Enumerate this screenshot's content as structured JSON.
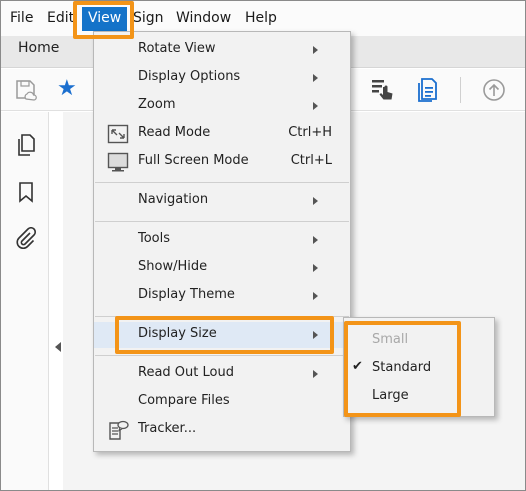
{
  "menubar": {
    "items": [
      "File",
      "Edit",
      "View",
      "Sign",
      "Window",
      "Help"
    ]
  },
  "tabs": {
    "home": "Home"
  },
  "view_menu": {
    "items": [
      {
        "label": "Rotate View",
        "submenu": true
      },
      {
        "label": "Display Options",
        "submenu": true
      },
      {
        "label": "Zoom",
        "submenu": true
      },
      {
        "label": "Read Mode",
        "shortcut": "Ctrl+H",
        "icon": "read-mode-icon"
      },
      {
        "label": "Full Screen Mode",
        "shortcut": "Ctrl+L",
        "icon": "full-screen-icon"
      },
      {
        "label": "Navigation",
        "submenu": true
      },
      {
        "label": "Tools",
        "submenu": true
      },
      {
        "label": "Show/Hide",
        "submenu": true
      },
      {
        "label": "Display Theme",
        "submenu": true
      },
      {
        "label": "Display Size",
        "submenu": true,
        "active": true
      },
      {
        "label": "Read Out Loud",
        "submenu": true
      },
      {
        "label": "Compare Files"
      },
      {
        "label": "Tracker...",
        "icon": "tracker-icon"
      }
    ]
  },
  "display_size_submenu": {
    "items": [
      {
        "label": "Small",
        "disabled": true,
        "checked": false
      },
      {
        "label": "Standard",
        "disabled": false,
        "checked": true
      },
      {
        "label": "Large",
        "disabled": false,
        "checked": false
      }
    ],
    "check_glyph": "✔"
  },
  "colors": {
    "accent": "#1473c9",
    "highlight": "#f39418",
    "active_item": "#dfe9f5"
  }
}
